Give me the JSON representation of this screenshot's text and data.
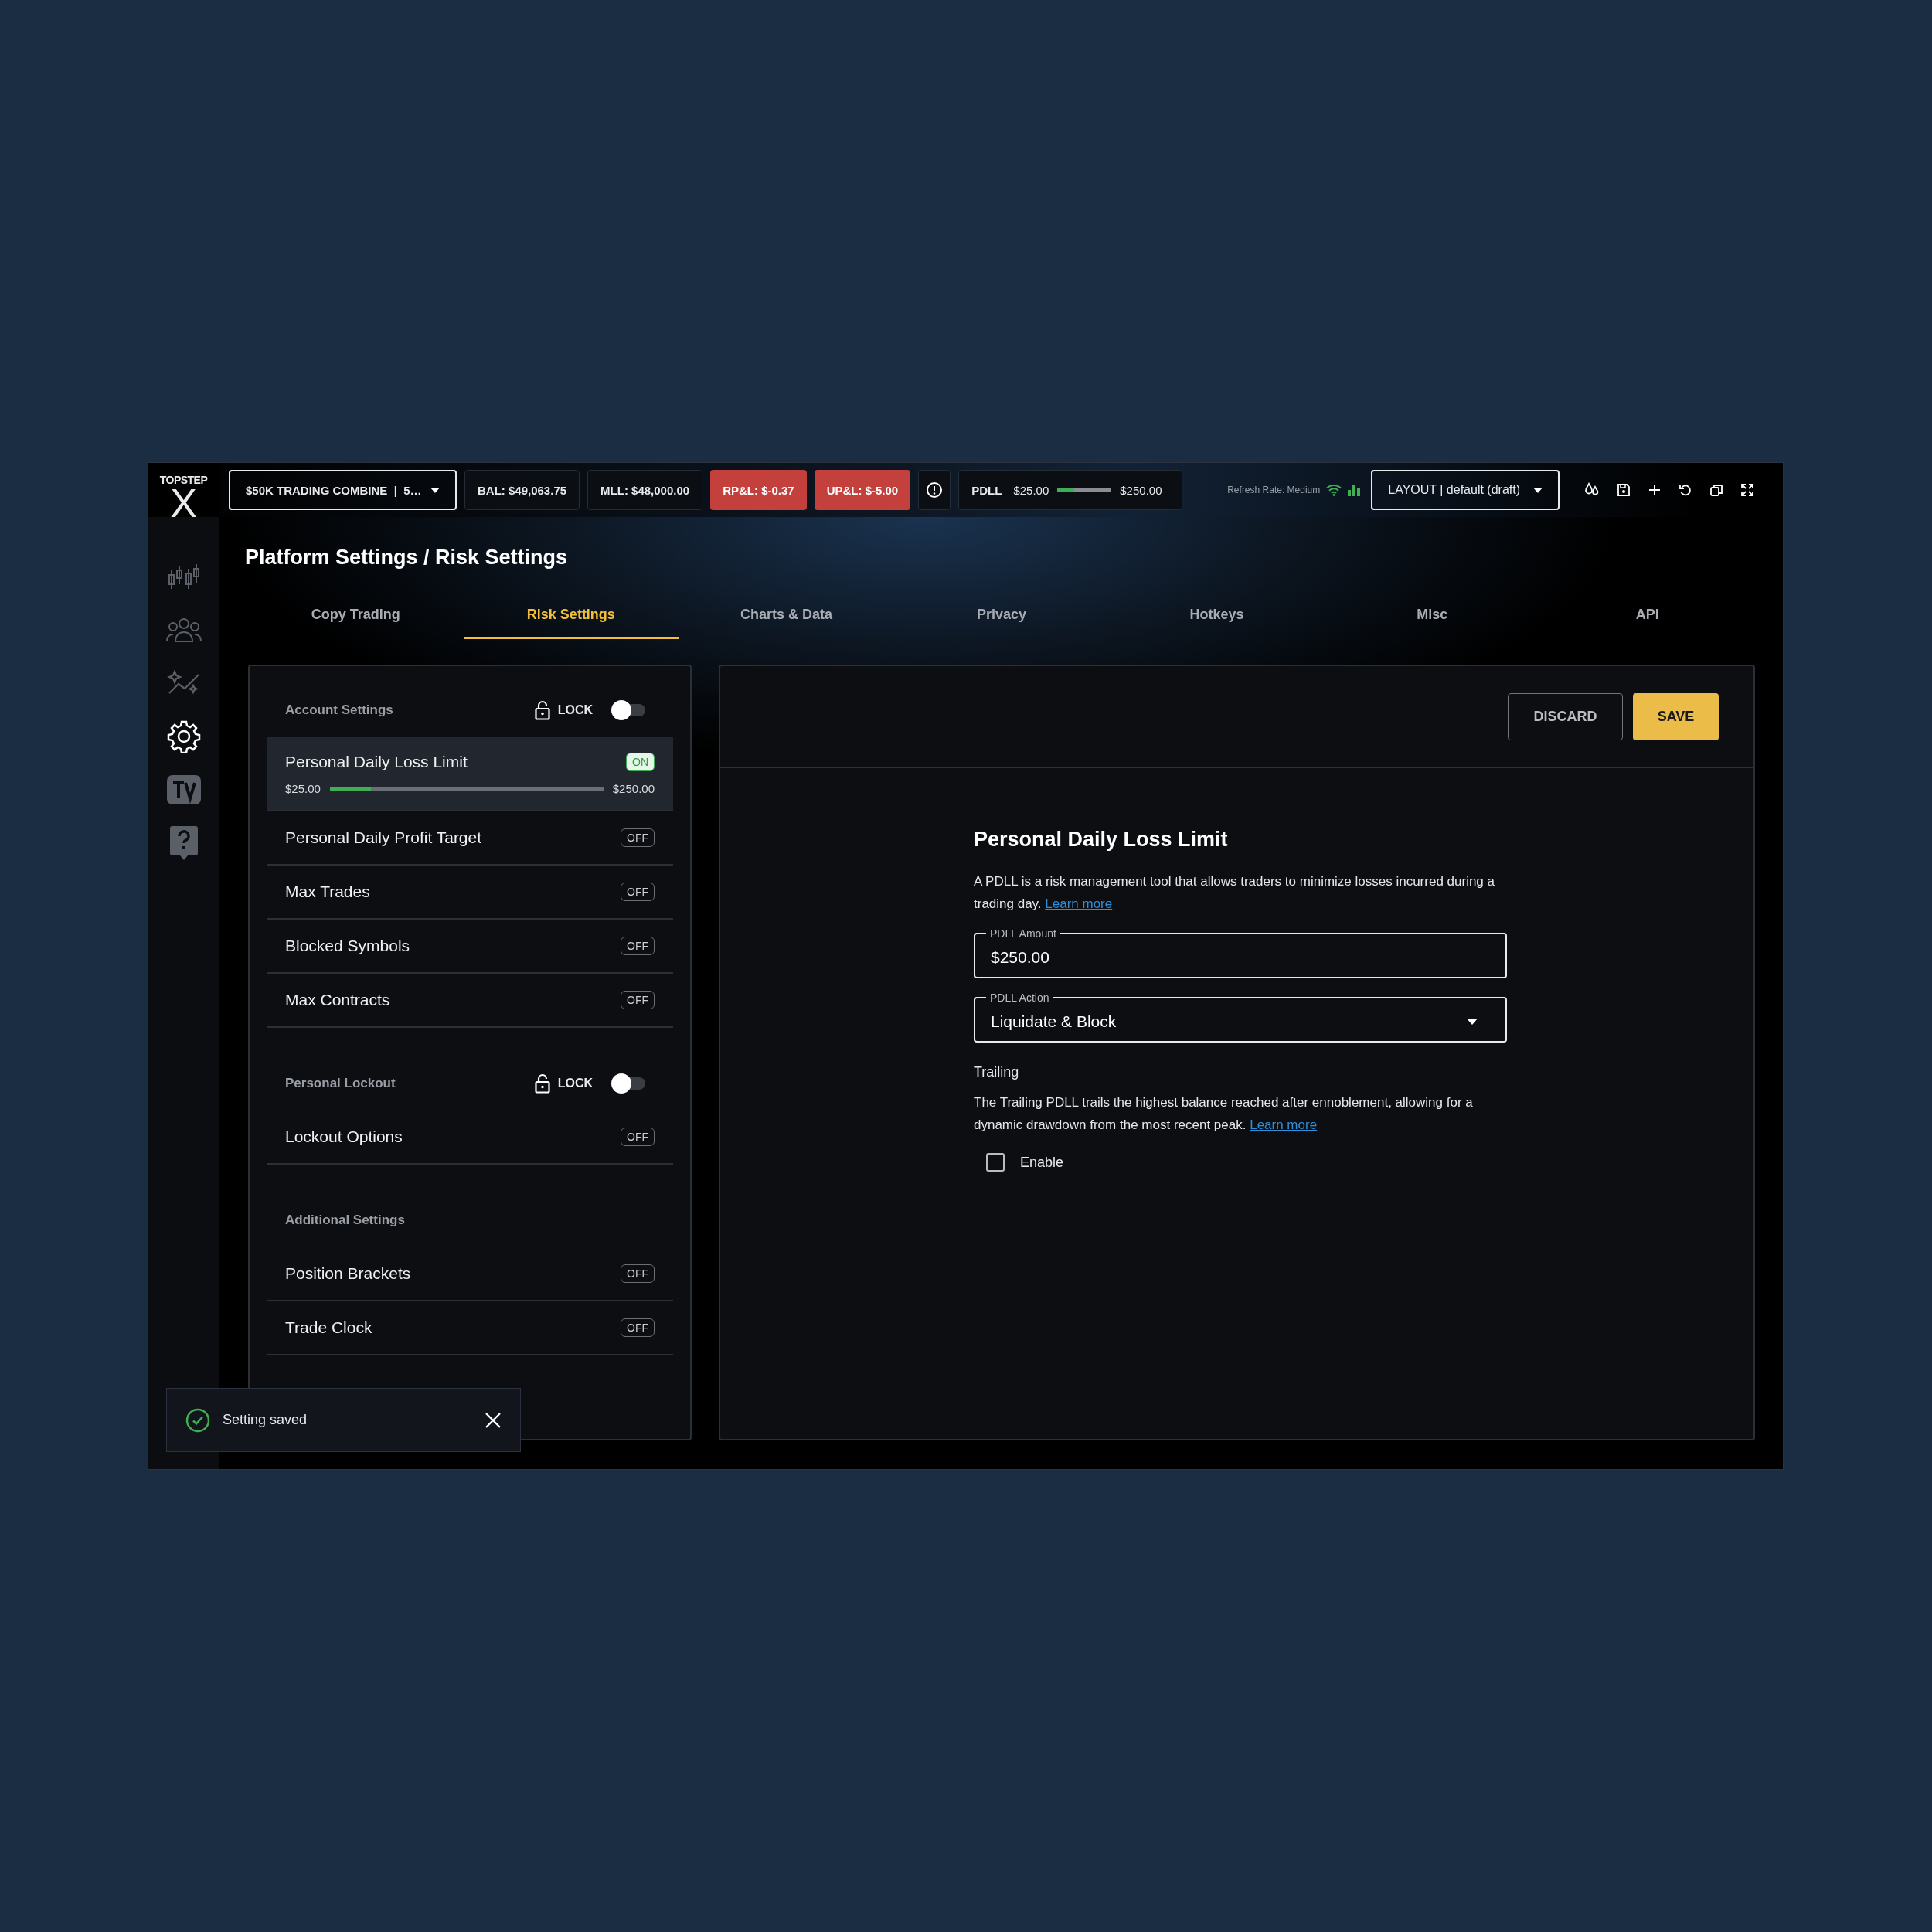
{
  "topbar": {
    "logo": {
      "wordmark": "TOPSTEP",
      "mark": "X"
    },
    "account": "$50K TRADING COMBINE  |  5…",
    "stats": [
      {
        "text": "BAL: $49,063.75",
        "kind": "neutral"
      },
      {
        "text": "MLL: $48,000.00",
        "kind": "neutral"
      },
      {
        "text": "RP&L: $-0.37",
        "kind": "loss"
      },
      {
        "text": "UP&L: $-5.00",
        "kind": "loss"
      }
    ],
    "pdll": {
      "label": "PDLL",
      "min": "$25.00",
      "max": "$250.00",
      "level": 0.31
    },
    "refresh": "Refresh Rate: Medium",
    "layout": "LAYOUT | default (draft)"
  },
  "sidebar": {
    "items": [
      {
        "kind": "candles",
        "selected": false
      },
      {
        "kind": "people",
        "selected": false
      },
      {
        "kind": "trend",
        "selected": false
      },
      {
        "kind": "gear",
        "selected": true
      },
      {
        "kind": "tv",
        "selected": false
      },
      {
        "kind": "help",
        "selected": false
      }
    ]
  },
  "title": "Platform Settings / Risk Settings",
  "tabs": [
    {
      "label": "Copy Trading",
      "selected": false
    },
    {
      "label": "Risk Settings",
      "selected": true
    },
    {
      "label": "Charts & Data",
      "selected": false
    },
    {
      "label": "Privacy",
      "selected": false
    },
    {
      "label": "Hotkeys",
      "selected": false
    },
    {
      "label": "Misc",
      "selected": false
    },
    {
      "label": "API",
      "selected": false
    }
  ],
  "sections": [
    {
      "title": "Account Settings",
      "lock": {
        "label": "LOCK",
        "on": false
      },
      "items": [
        {
          "label": "Personal Daily Loss Limit",
          "badge": "ON",
          "on": true,
          "selected": true,
          "slider": {
            "min": "$25.00",
            "max": "$250.00",
            "level": 0.15
          }
        },
        {
          "label": "Personal Daily Profit Target",
          "badge": "OFF",
          "on": false,
          "selected": false
        },
        {
          "label": "Max Trades",
          "badge": "OFF",
          "on": false,
          "selected": false
        },
        {
          "label": "Blocked Symbols",
          "badge": "OFF",
          "on": false,
          "selected": false
        },
        {
          "label": "Max Contracts",
          "badge": "OFF",
          "on": false,
          "selected": false
        }
      ]
    },
    {
      "title": "Personal Lockout",
      "lock": {
        "label": "LOCK",
        "on": false
      },
      "items": [
        {
          "label": "Lockout Options",
          "badge": "OFF",
          "on": false,
          "selected": false
        }
      ]
    },
    {
      "title": "Additional Settings",
      "items": [
        {
          "label": "Position Brackets",
          "badge": "OFF",
          "on": false,
          "selected": false
        },
        {
          "label": "Trade Clock",
          "badge": "OFF",
          "on": false,
          "selected": false
        }
      ]
    }
  ],
  "buttons": [
    {
      "label": "DISCARD",
      "kind": "secondary"
    },
    {
      "label": "SAVE",
      "kind": "primary"
    }
  ],
  "detail": {
    "heading": "Personal Daily Loss Limit",
    "description": "A PDLL is a risk management tool that allows traders to minimize losses incurred during a trading day.",
    "link": "Learn more",
    "fields": [
      {
        "label": "PDLL Amount",
        "value": "$250.00",
        "kind": "text"
      },
      {
        "label": "PDLL Action",
        "value": "Liquidate & Block",
        "kind": "select"
      }
    ],
    "trailing": {
      "title": "Trailing",
      "text": "The Trailing PDLL trails the highest balance reached after ennoblement, allowing for a dynamic drawdown from the most recent peak.",
      "link": "Learn more",
      "checkbox": {
        "label": "Enable",
        "checked": false
      }
    }
  },
  "toast": {
    "text": "Setting saved"
  }
}
